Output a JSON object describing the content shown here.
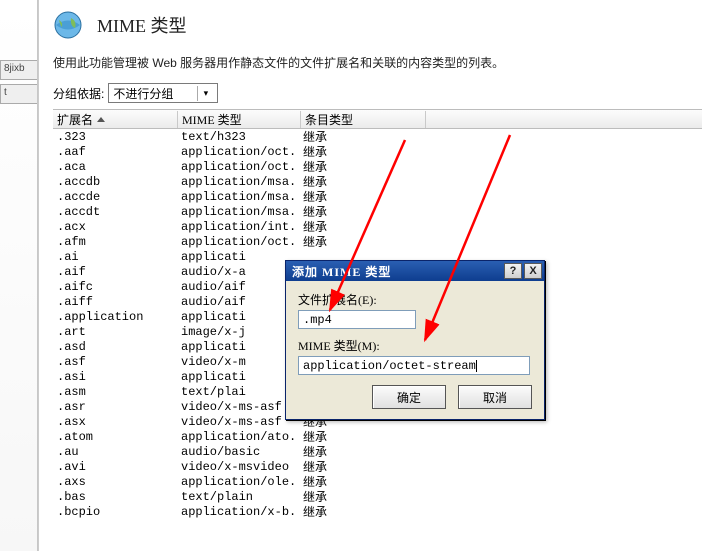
{
  "left_tabs": [
    "8jixb",
    "t"
  ],
  "page_title": "MIME 类型",
  "description": "使用此功能管理被 Web 服务器用作静态文件的文件扩展名和关联的内容类型的列表。",
  "group_label": "分组依据:",
  "group_value": "不进行分组",
  "columns": {
    "ext": "扩展名",
    "mime": "MIME 类型",
    "entry": "条目类型"
  },
  "rows": [
    {
      "ext": ".323",
      "mime": "text/h323",
      "entry": "继承"
    },
    {
      "ext": ".aaf",
      "mime": "application/oct...",
      "entry": "继承"
    },
    {
      "ext": ".aca",
      "mime": "application/oct...",
      "entry": "继承"
    },
    {
      "ext": ".accdb",
      "mime": "application/msa...",
      "entry": "继承"
    },
    {
      "ext": ".accde",
      "mime": "application/msa...",
      "entry": "继承"
    },
    {
      "ext": ".accdt",
      "mime": "application/msa...",
      "entry": "继承"
    },
    {
      "ext": ".acx",
      "mime": "application/int...",
      "entry": "继承"
    },
    {
      "ext": ".afm",
      "mime": "application/oct...",
      "entry": "继承"
    },
    {
      "ext": ".ai",
      "mime": "applicati",
      "entry": ""
    },
    {
      "ext": ".aif",
      "mime": "audio/x-a",
      "entry": ""
    },
    {
      "ext": ".aifc",
      "mime": "audio/aif",
      "entry": ""
    },
    {
      "ext": ".aiff",
      "mime": "audio/aif",
      "entry": ""
    },
    {
      "ext": ".application",
      "mime": "applicati",
      "entry": ""
    },
    {
      "ext": ".art",
      "mime": "image/x-j",
      "entry": ""
    },
    {
      "ext": ".asd",
      "mime": "applicati",
      "entry": ""
    },
    {
      "ext": ".asf",
      "mime": "video/x-m",
      "entry": ""
    },
    {
      "ext": ".asi",
      "mime": "applicati",
      "entry": ""
    },
    {
      "ext": ".asm",
      "mime": "text/plai",
      "entry": ""
    },
    {
      "ext": ".asr",
      "mime": "video/x-ms-asf",
      "entry": "继承"
    },
    {
      "ext": ".asx",
      "mime": "video/x-ms-asf",
      "entry": "继承"
    },
    {
      "ext": ".atom",
      "mime": "application/ato...",
      "entry": "继承"
    },
    {
      "ext": ".au",
      "mime": "audio/basic",
      "entry": "继承"
    },
    {
      "ext": ".avi",
      "mime": "video/x-msvideo",
      "entry": "继承"
    },
    {
      "ext": ".axs",
      "mime": "application/ole...",
      "entry": "继承"
    },
    {
      "ext": ".bas",
      "mime": "text/plain",
      "entry": "继承"
    },
    {
      "ext": ".bcpio",
      "mime": "application/x-b...",
      "entry": "继承"
    }
  ],
  "dialog": {
    "title": "添加 MIME 类型",
    "ext_label": "文件扩展名(E):",
    "ext_value": ".mp4",
    "mime_label": "MIME 类型(M):",
    "mime_value": "application/octet-stream",
    "ok": "确定",
    "cancel": "取消",
    "help": "?",
    "close": "X"
  }
}
